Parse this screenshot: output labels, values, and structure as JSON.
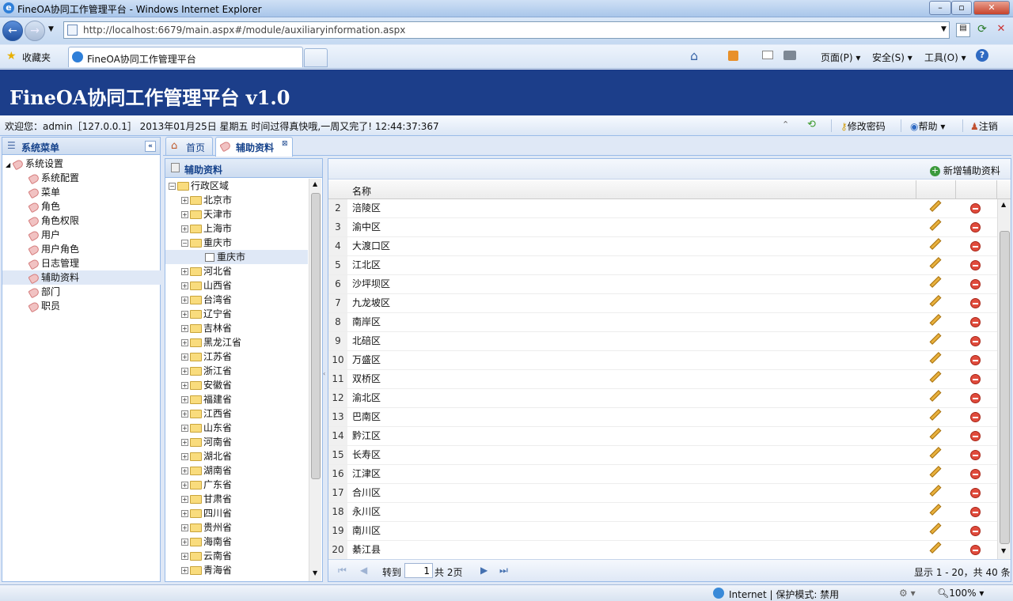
{
  "window": {
    "title": "FineOA协同工作管理平台 - Windows Internet Explorer"
  },
  "address": {
    "url": "http://localhost:6679/main.aspx#/module/auxiliaryinformation.aspx"
  },
  "favbar": {
    "favorites": "收藏夹",
    "tab_title": "FineOA协同工作管理平台",
    "page": "页面(P)",
    "safety": "安全(S)",
    "tools": "工具(O)"
  },
  "app": {
    "title": "FineOA协同工作管理平台 v1.0"
  },
  "infobar": {
    "welcome": "欢迎您：admin［127.0.0.1］ 2013年01月25日 星期五 时间过得真快哦,一周又完了! 12:44:37:367",
    "change_password": "修改密码",
    "help": "帮助",
    "logout": "注销"
  },
  "sidebar": {
    "title": "系统菜单",
    "root": "系统设置",
    "items": [
      "系统配置",
      "菜单",
      "角色",
      "角色权限",
      "用户",
      "用户角色",
      "日志管理",
      "辅助资料",
      "部门",
      "职员"
    ],
    "selected": "辅助资料"
  },
  "tabs": [
    {
      "label": "首页"
    },
    {
      "label": "辅助资料"
    }
  ],
  "tree": {
    "title": "辅助资料",
    "root": "行政区域",
    "nodes": [
      "北京市",
      "天津市",
      "上海市",
      "重庆市",
      "重庆市",
      "河北省",
      "山西省",
      "台湾省",
      "辽宁省",
      "吉林省",
      "黑龙江省",
      "江苏省",
      "浙江省",
      "安徽省",
      "福建省",
      "江西省",
      "山东省",
      "河南省",
      "湖北省",
      "湖南省",
      "广东省",
      "甘肃省",
      "四川省",
      "贵州省",
      "海南省",
      "云南省",
      "青海省"
    ]
  },
  "grid": {
    "add_button": "新增辅助资料",
    "column_name": "名称",
    "rows": [
      {
        "no": "2",
        "name": "涪陵区"
      },
      {
        "no": "3",
        "name": "渝中区"
      },
      {
        "no": "4",
        "name": "大渡口区"
      },
      {
        "no": "5",
        "name": "江北区"
      },
      {
        "no": "6",
        "name": "沙坪坝区"
      },
      {
        "no": "7",
        "name": "九龙坡区"
      },
      {
        "no": "8",
        "name": "南岸区"
      },
      {
        "no": "9",
        "name": "北碚区"
      },
      {
        "no": "10",
        "name": "万盛区"
      },
      {
        "no": "11",
        "name": "双桥区"
      },
      {
        "no": "12",
        "name": "渝北区"
      },
      {
        "no": "13",
        "name": "巴南区"
      },
      {
        "no": "14",
        "name": "黔江区"
      },
      {
        "no": "15",
        "name": "长寿区"
      },
      {
        "no": "16",
        "name": "江津区"
      },
      {
        "no": "17",
        "name": "合川区"
      },
      {
        "no": "18",
        "name": "永川区"
      },
      {
        "no": "19",
        "name": "南川区"
      },
      {
        "no": "20",
        "name": "綦江县"
      }
    ],
    "pager": {
      "goto": "转到",
      "page_value": "1",
      "total_pages": "共 2页",
      "summary": "显示 1 - 20，共 40 条"
    }
  },
  "statusbar": {
    "zone": "Internet | 保护模式: 禁用",
    "zoom": "100%"
  }
}
